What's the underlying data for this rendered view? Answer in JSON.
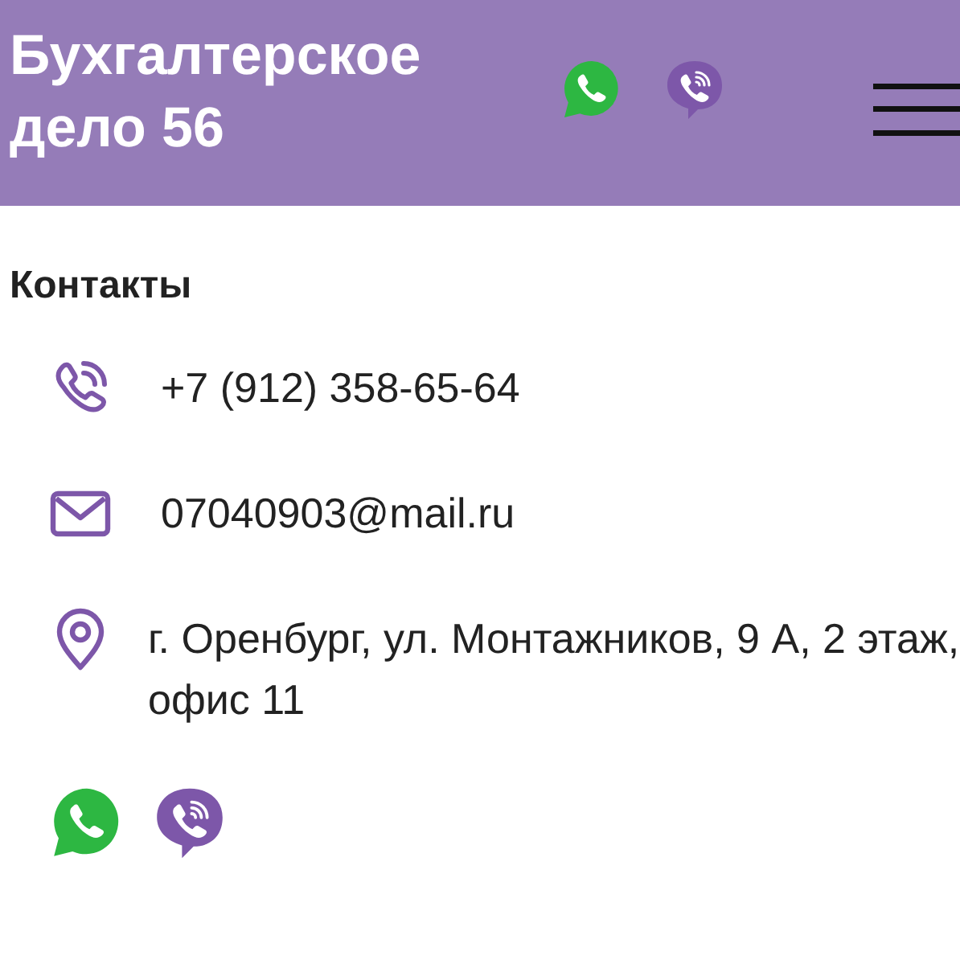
{
  "header": {
    "title": "Бухгалтерское дело 56",
    "messengers": [
      {
        "kind": "whatsapp"
      },
      {
        "kind": "viber"
      }
    ]
  },
  "contacts": {
    "heading": "Контакты",
    "items": [
      {
        "kind": "phone",
        "text": "+7 (912) 358-65-64"
      },
      {
        "kind": "email",
        "text": "07040903@mail.ru"
      },
      {
        "kind": "address",
        "text": "г. Оренбург, ул. Монтажников, 9 А, 2 этаж, офис 11"
      }
    ],
    "messengers": [
      {
        "kind": "whatsapp"
      },
      {
        "kind": "viber"
      }
    ]
  }
}
